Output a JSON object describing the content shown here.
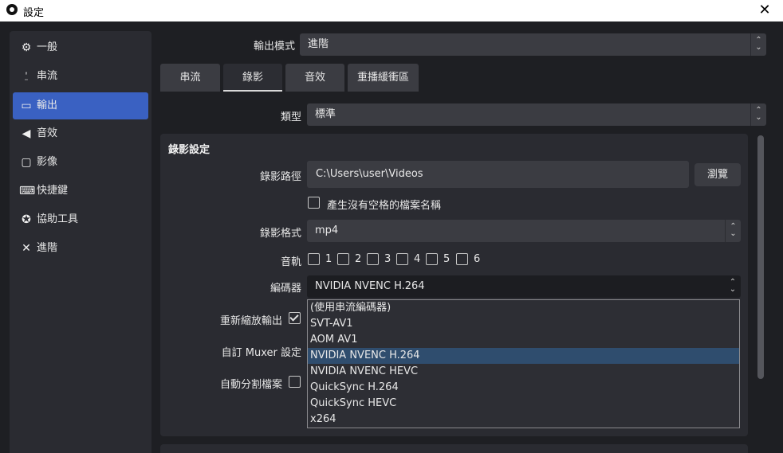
{
  "window": {
    "title": "設定",
    "close_glyph": "✕"
  },
  "sidebar": {
    "items": [
      {
        "label": "一般",
        "icon": "gear-icon",
        "glyph": "⚙"
      },
      {
        "label": "串流",
        "icon": "antenna-icon",
        "glyph": "⍘"
      },
      {
        "label": "輸出",
        "icon": "output-icon",
        "glyph": "▭"
      },
      {
        "label": "音效",
        "icon": "speaker-icon",
        "glyph": "◀"
      },
      {
        "label": "影像",
        "icon": "monitor-icon",
        "glyph": "▢"
      },
      {
        "label": "快捷鍵",
        "icon": "keyboard-icon",
        "glyph": "⌨"
      },
      {
        "label": "協助工具",
        "icon": "accessibility-icon",
        "glyph": "✪"
      },
      {
        "label": "進階",
        "icon": "wrench-icon",
        "glyph": "✕"
      }
    ],
    "active_index": 2
  },
  "output_mode": {
    "label": "輸出模式",
    "value": "進階"
  },
  "tabs": [
    {
      "label": "串流"
    },
    {
      "label": "錄影"
    },
    {
      "label": "音效"
    },
    {
      "label": "重播緩衝區"
    }
  ],
  "active_tab": 1,
  "type_row": {
    "label": "類型",
    "value": "標準"
  },
  "recording": {
    "group_title": "錄影設定",
    "path_label": "錄影路徑",
    "path_value": "C:\\Users\\user\\Videos",
    "browse_label": "瀏覽",
    "nospace_label": "產生沒有空格的檔案名稱",
    "nospace_checked": false,
    "format_label": "錄影格式",
    "format_value": "mp4",
    "tracks_label": "音軌",
    "tracks": [
      {
        "label": "1",
        "checked": false
      },
      {
        "label": "2",
        "checked": false
      },
      {
        "label": "3",
        "checked": false
      },
      {
        "label": "4",
        "checked": false
      },
      {
        "label": "5",
        "checked": false
      },
      {
        "label": "6",
        "checked": false
      }
    ],
    "encoder_label": "編碼器",
    "encoder_value": "NVIDIA NVENC H.264",
    "rescale_label": "重新縮放輸出",
    "rescale_checked": true,
    "muxer_label": "自訂 Muxer 設定",
    "autosplit_label": "自動分割檔案",
    "autosplit_checked": false
  },
  "encoder_options": [
    "(使用串流編碼器)",
    "SVT-AV1",
    "AOM AV1",
    "NVIDIA NVENC H.264",
    "NVIDIA NVENC HEVC",
    "QuickSync H.264",
    "QuickSync HEVC",
    "x264"
  ],
  "encoder_selected_index": 3,
  "colors": {
    "background": "#1e1f23",
    "panel": "#2a2b31",
    "control": "#3b3c42",
    "accent": "#3a61c2",
    "selection": "#2f4d6e"
  }
}
